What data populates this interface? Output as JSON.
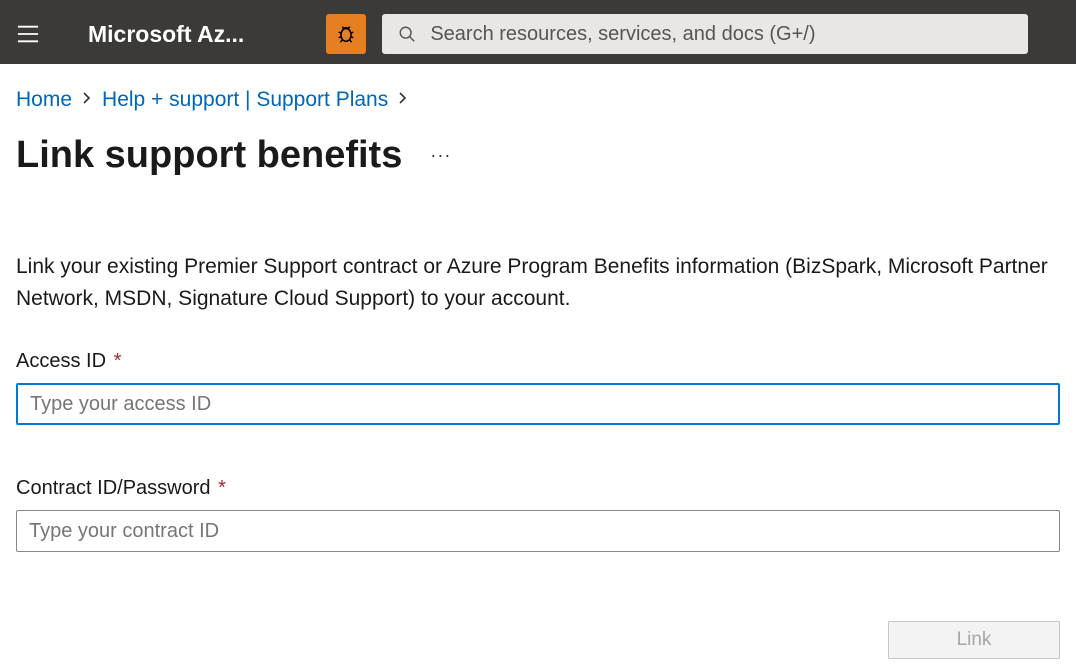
{
  "header": {
    "brand": "Microsoft Az...",
    "search_placeholder": "Search resources, services, and docs (G+/)"
  },
  "breadcrumb": {
    "home": "Home",
    "help": "Help + support | Support Plans"
  },
  "page": {
    "title": "Link support benefits",
    "description": "Link your existing Premier Support contract or Azure Program Benefits information (BizSpark, Microsoft Partner Network, MSDN, Signature Cloud Support) to your account."
  },
  "form": {
    "access_id_label": "Access ID",
    "access_id_placeholder": "Type your access ID",
    "contract_id_label": "Contract ID/Password",
    "contract_id_placeholder": "Type your contract ID",
    "required_mark": "*",
    "link_button": "Link"
  }
}
